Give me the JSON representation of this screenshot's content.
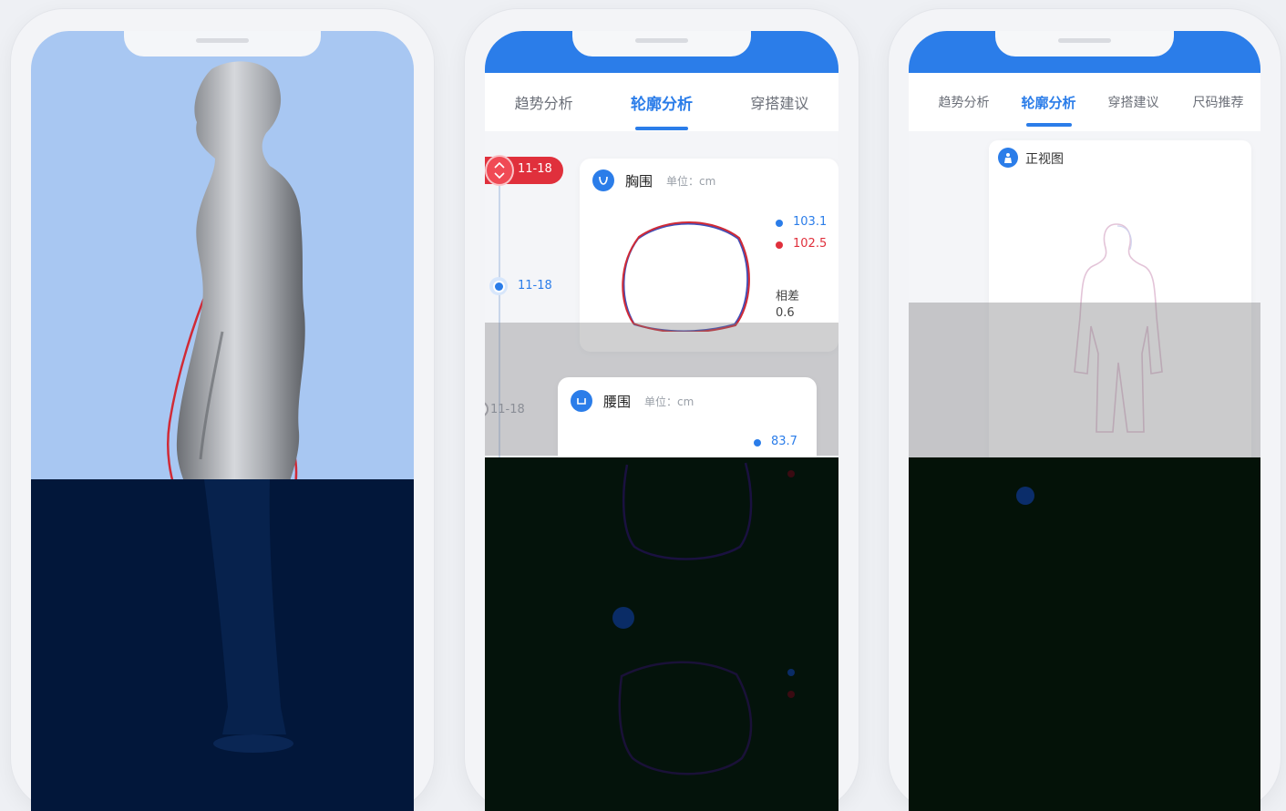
{
  "phone2": {
    "tabs": [
      {
        "label": "趋势分析",
        "active": false
      },
      {
        "label": "轮廓分析",
        "active": true
      },
      {
        "label": "穿搭建议",
        "active": false
      }
    ],
    "timeline": [
      {
        "date": "11-18",
        "state": "current"
      },
      {
        "date": "11-18",
        "state": "selected"
      },
      {
        "date": "11-18",
        "state": "default"
      }
    ],
    "cards": [
      {
        "title": "胸围",
        "unit_label": "单位：cm",
        "legend": [
          {
            "value": "103.1",
            "color": "#2b7de9"
          },
          {
            "value": "102.5",
            "color": "#e0303c"
          }
        ],
        "diff_label": "相差",
        "diff_value": "0.6"
      },
      {
        "title": "腰围",
        "unit_label": "单位：cm",
        "legend": [
          {
            "value": "83.7",
            "color": "#2b7de9"
          }
        ]
      }
    ]
  },
  "phone3": {
    "tabs": [
      {
        "label": "趋势分析",
        "active": false
      },
      {
        "label": "轮廓分析",
        "active": true
      },
      {
        "label": "穿搭建议",
        "active": false
      },
      {
        "label": "尺码推荐",
        "active": false
      }
    ],
    "view_title": "正视图"
  },
  "colors": {
    "primary": "#2b7de9",
    "compare": "#e0303c",
    "model_bg": "#a8c7f2"
  }
}
